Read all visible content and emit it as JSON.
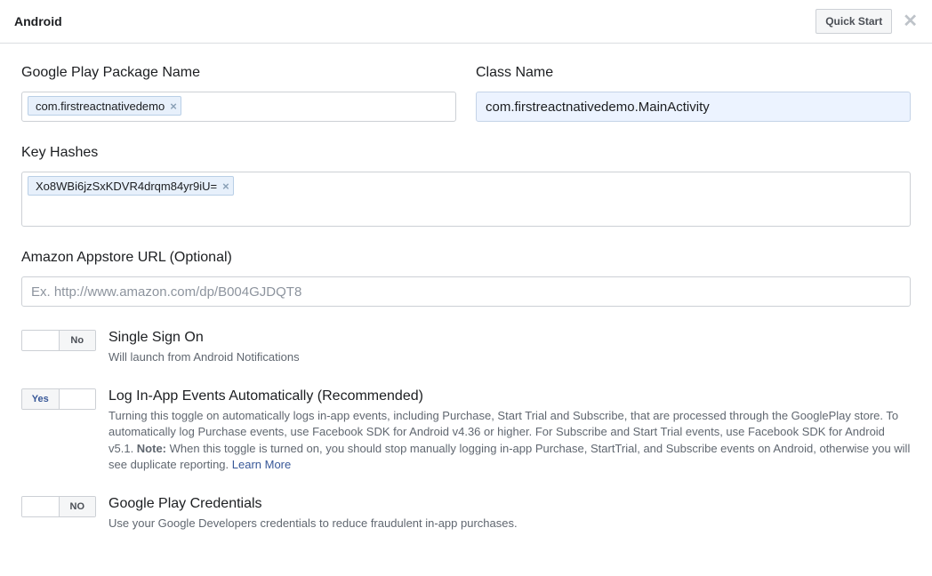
{
  "header": {
    "title": "Android",
    "quick_start": "Quick Start"
  },
  "packageName": {
    "label": "Google Play Package Name",
    "token": "com.firstreactnativedemo"
  },
  "className": {
    "label": "Class Name",
    "value": "com.firstreactnativedemo.MainActivity"
  },
  "keyHashes": {
    "label": "Key Hashes",
    "token": "Xo8WBi6jzSxKDVR4drqm84yr9iU="
  },
  "amazon": {
    "label": "Amazon Appstore URL (Optional)",
    "placeholder": "Ex. http://www.amazon.com/dp/B004GJDQT8"
  },
  "sso": {
    "toggle_text": "No",
    "title": "Single Sign On",
    "sub": "Will launch from Android Notifications"
  },
  "logEvents": {
    "toggle_text": "Yes",
    "title": "Log In-App Events Automatically (Recommended)",
    "sub1": "Turning this toggle on automatically logs in-app events, including Purchase, Start Trial and Subscribe, that are processed through the GooglePlay store. To automatically log Purchase events, use Facebook SDK for Android v4.36 or higher. For Subscribe and Start Trial events, use Facebook SDK for Android v5.1. ",
    "note_label": "Note:",
    "sub2": " When this toggle is turned on, you should stop manually logging in-app Purchase, StartTrial, and Subscribe events on Android, otherwise you will see duplicate reporting. ",
    "learn": "Learn More"
  },
  "gpCred": {
    "toggle_text": "NO",
    "title": "Google Play Credentials",
    "sub": "Use your Google Developers credentials to reduce fraudulent in-app purchases."
  }
}
